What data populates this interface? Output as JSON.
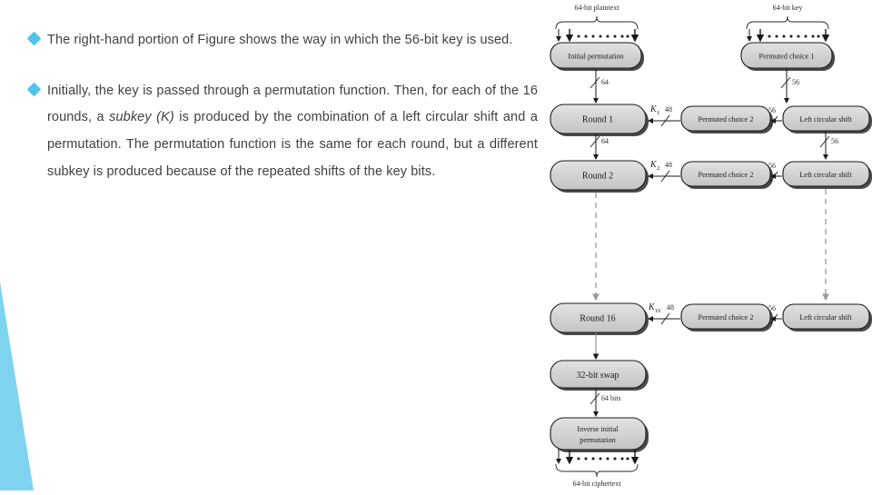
{
  "slide": {
    "background_color": "#ffffff",
    "accent_color": "#4ec3e8",
    "text_color": "#404040"
  },
  "content": {
    "bullets": [
      {
        "marker": "diamond-bullet",
        "text": "The right-hand portion of Figure shows the way in which the 56-bit key is used."
      },
      {
        "marker": "diamond-bullet",
        "text_part1": " Initially, the key is passed through a permutation function. Then, for each of the 16 rounds, a ",
        "emphasis": "subkey (K)",
        "text_part2": " is produced by the combination of a left circular shift and a permutation. The permutation function is the same for each round, but a different subkey is produced because of the repeated shifts of the key bits."
      }
    ]
  },
  "diagram": {
    "name": "des-encryption-block-diagram",
    "inputs": {
      "plaintext": "64-bit plaintext",
      "key": "64-bit key"
    },
    "output": {
      "ciphertext": "64-bit ciphertext"
    },
    "data_path_boxes": [
      {
        "label": "Initial permutation"
      },
      {
        "label": "Round 1"
      },
      {
        "label": "Round 2"
      },
      {
        "label": "Round 16"
      },
      {
        "label": "32-bit swap"
      },
      {
        "label": "Inverse initial",
        "label2": "permutation"
      }
    ],
    "key_path_boxes": [
      {
        "label": "Permuted choice 1"
      },
      {
        "label": "Permuted choice 2"
      },
      {
        "label": "Left circular shift"
      },
      {
        "label": "Permuted choice 2"
      },
      {
        "label": "Left circular shift"
      },
      {
        "label": "Permuted choice 2"
      },
      {
        "label": "Left circular shift"
      }
    ],
    "subkeys": [
      {
        "symbol": "K",
        "subscript": "1",
        "bits": "48"
      },
      {
        "symbol": "K",
        "subscript": "2",
        "bits": "48"
      },
      {
        "symbol": "K",
        "subscript": "16",
        "bits": "48"
      }
    ],
    "bit_labels": {
      "ip_out": "64",
      "round1_out": "64",
      "swap_out": "64 bits",
      "pc1_out": "56",
      "shift_out_1": "56",
      "shift_out_2": "56",
      "pc2_in_1": "56",
      "pc2_in_2": "56",
      "pc2_in_3": "56"
    }
  }
}
